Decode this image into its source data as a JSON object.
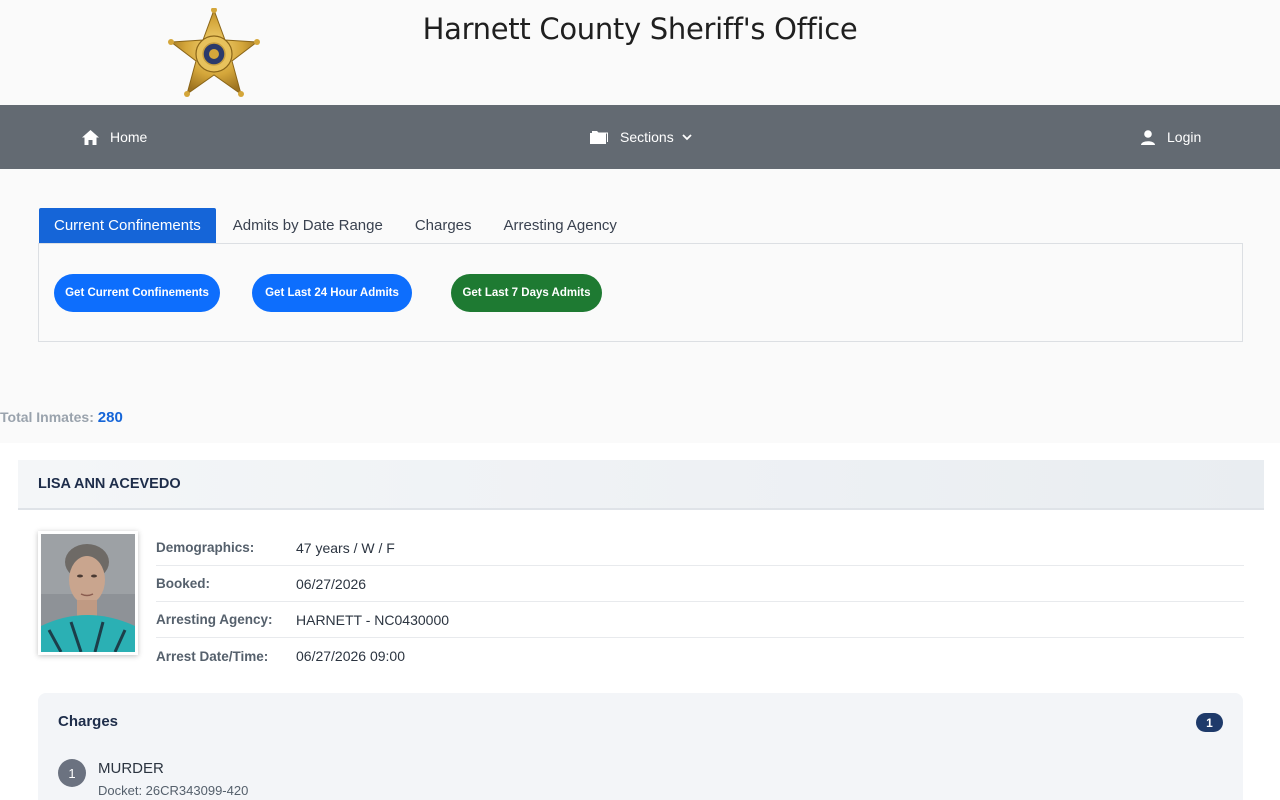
{
  "header": {
    "title": "Harnett County Sheriff's Office",
    "logo_icon": "sheriff-star-badge"
  },
  "nav": {
    "home": "Home",
    "sections": "Sections",
    "login": "Login"
  },
  "tabs": [
    {
      "label": "Current Confinements",
      "active": true
    },
    {
      "label": "Admits by Date Range",
      "active": false
    },
    {
      "label": "Charges",
      "active": false
    },
    {
      "label": "Arresting Agency",
      "active": false
    }
  ],
  "buttons": {
    "current": "Get Current Confinements",
    "last24": "Get Last 24 Hour Admits",
    "last7": "Get Last 7 Days Admits"
  },
  "summary": {
    "label": "Total Inmates:",
    "count": "280"
  },
  "inmate": {
    "name": "LISA ANN ACEVEDO",
    "fields": [
      {
        "label": "Demographics:",
        "value": "47 years / W / F"
      },
      {
        "label": "Booked:",
        "value": "06/27/2026"
      },
      {
        "label": "Arresting Agency:",
        "value": "HARNETT - NC0430000"
      },
      {
        "label": "Arrest Date/Time:",
        "value": "06/27/2026 09:00"
      }
    ],
    "charges_title": "Charges",
    "charges_count": "1",
    "charges": [
      {
        "num": "1",
        "name": "MURDER",
        "docket": "Docket: 26CR343099-420"
      }
    ]
  },
  "colors": {
    "accent": "#1565d8",
    "nav_bg": "#636a72",
    "green": "#1e7a32"
  }
}
